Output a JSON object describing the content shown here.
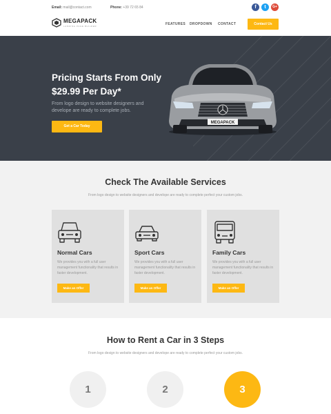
{
  "topbar": {
    "email_label": "Email:",
    "email_value": "mail@contact.com",
    "phone_label": "Phone:",
    "phone_value": "+39 72 65 84",
    "social": [
      {
        "name": "facebook-icon",
        "glyph": "f",
        "color": "#3b5998"
      },
      {
        "name": "twitter-icon",
        "glyph": "t",
        "color": "#1da1f2"
      },
      {
        "name": "google-plus-icon",
        "glyph": "G+",
        "color": "#dd4b39"
      }
    ]
  },
  "header": {
    "logo_text": "MEGAPACK",
    "logo_sub": "LANDING PAGE BUILDER",
    "nav": [
      "FEATURES",
      "DROPDOWN",
      "CONTACT"
    ],
    "cta_label": "Contact Us"
  },
  "hero": {
    "title_line1": "Pricing Starts From Only",
    "title_line2": "$29.99 Per Day*",
    "description": "From logo design to website designers and develope are ready to complete jobs.",
    "button_label": "Get a Car Today",
    "plate_text": "MEGAPACK",
    "bg_color": "#3a4049"
  },
  "services": {
    "title": "Check The Available Services",
    "subtitle": "From logo design to website designers and develope are ready to complete perfect your custom jobs.",
    "cards": [
      {
        "title": "Normal Cars",
        "icon": "sedan-car-icon",
        "description": "We provides you with a full user management functionality that results in faster development.",
        "button": "Make an Offer"
      },
      {
        "title": "Sport Cars",
        "icon": "sport-car-icon",
        "description": "We provides you with a full user management functionality that results in faster development.",
        "button": "Make an Offer"
      },
      {
        "title": "Family Cars",
        "icon": "van-icon",
        "description": "We provides you with a full user management functionality that results in faster development.",
        "button": "Make an Offer"
      }
    ]
  },
  "steps": {
    "title": "How to Rent a Car in 3 Steps",
    "subtitle": "From logo design to website designers and develope are ready to complete perfect your custom jobs.",
    "items": [
      "1",
      "2",
      "3"
    ],
    "active_index": 2
  },
  "colors": {
    "accent": "#fdb813",
    "dark": "#3a4049",
    "light_bg": "#f2f2f2",
    "card_bg": "#e0e0e0"
  }
}
